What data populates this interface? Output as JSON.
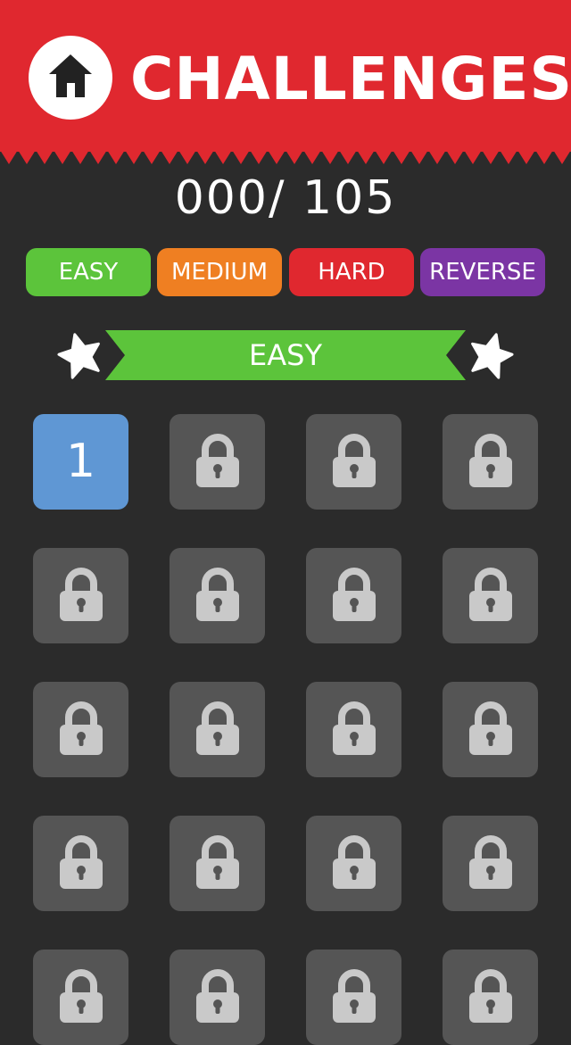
{
  "header": {
    "title": "CHALLENGES",
    "home_icon": "home-icon",
    "color": "#e0282f"
  },
  "progress": {
    "text": "000/ 105"
  },
  "filters": [
    {
      "label": "EASY",
      "color": "#5cc43b"
    },
    {
      "label": "MEDIUM",
      "color": "#ef7f22"
    },
    {
      "label": "HARD",
      "color": "#e0282f"
    },
    {
      "label": "REVERSE",
      "color": "#7b35a4"
    }
  ],
  "section": {
    "label": "EASY",
    "color": "#5cc43b",
    "star_icon": "star-icon"
  },
  "levels": [
    {
      "number": "1",
      "locked": false
    },
    {
      "locked": true
    },
    {
      "locked": true
    },
    {
      "locked": true
    },
    {
      "locked": true
    },
    {
      "locked": true
    },
    {
      "locked": true
    },
    {
      "locked": true
    },
    {
      "locked": true
    },
    {
      "locked": true
    },
    {
      "locked": true
    },
    {
      "locked": true
    },
    {
      "locked": true
    },
    {
      "locked": true
    },
    {
      "locked": true
    },
    {
      "locked": true
    },
    {
      "locked": true
    },
    {
      "locked": true
    },
    {
      "locked": true
    },
    {
      "locked": true
    }
  ],
  "colors": {
    "background": "#2b2b2b",
    "tile_locked": "#555555",
    "tile_unlocked": "#5f97d4",
    "lock": "#c9c9c9"
  }
}
